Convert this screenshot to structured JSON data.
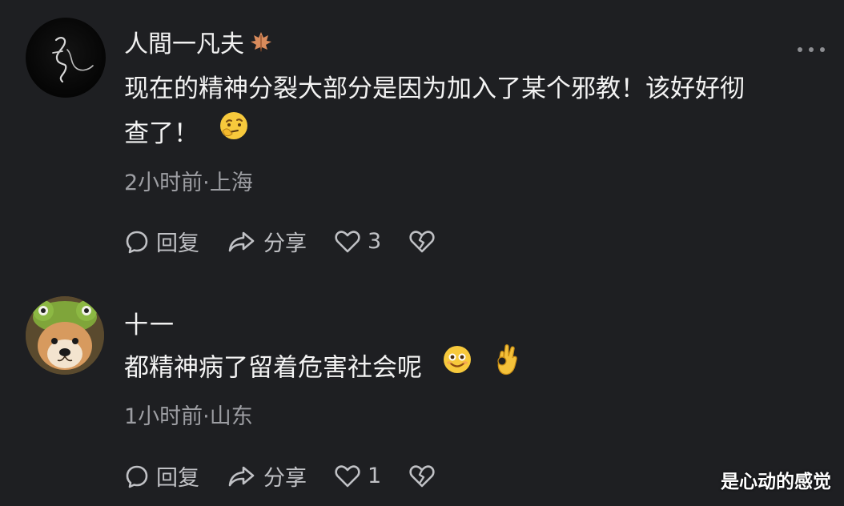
{
  "comments": [
    {
      "username": "人間一凡夫",
      "text_line1": "现在的精神分裂大部分是因为加入了某个邪教！该好好彻",
      "text_line2": "查了！",
      "meta": "2小时前·上海",
      "reply_label": "回复",
      "share_label": "分享",
      "like_count": "3",
      "badge_icon": "maple-leaf-icon",
      "emoji_icon": "thinking-face-emoji"
    },
    {
      "username": "十一",
      "text_line1": "都精神病了留着危害社会呢",
      "meta": "1小时前·山东",
      "reply_label": "回复",
      "share_label": "分享",
      "like_count": "1",
      "emoji_icons": [
        "smiling-face-emoji",
        "ok-hand-emoji"
      ]
    }
  ],
  "watermark": "是心动的感觉",
  "colors": {
    "background": "#1e1f22",
    "primary_text": "#f3f3f3",
    "secondary_text": "#9d9ea3",
    "icon": "#c0c1c5"
  }
}
